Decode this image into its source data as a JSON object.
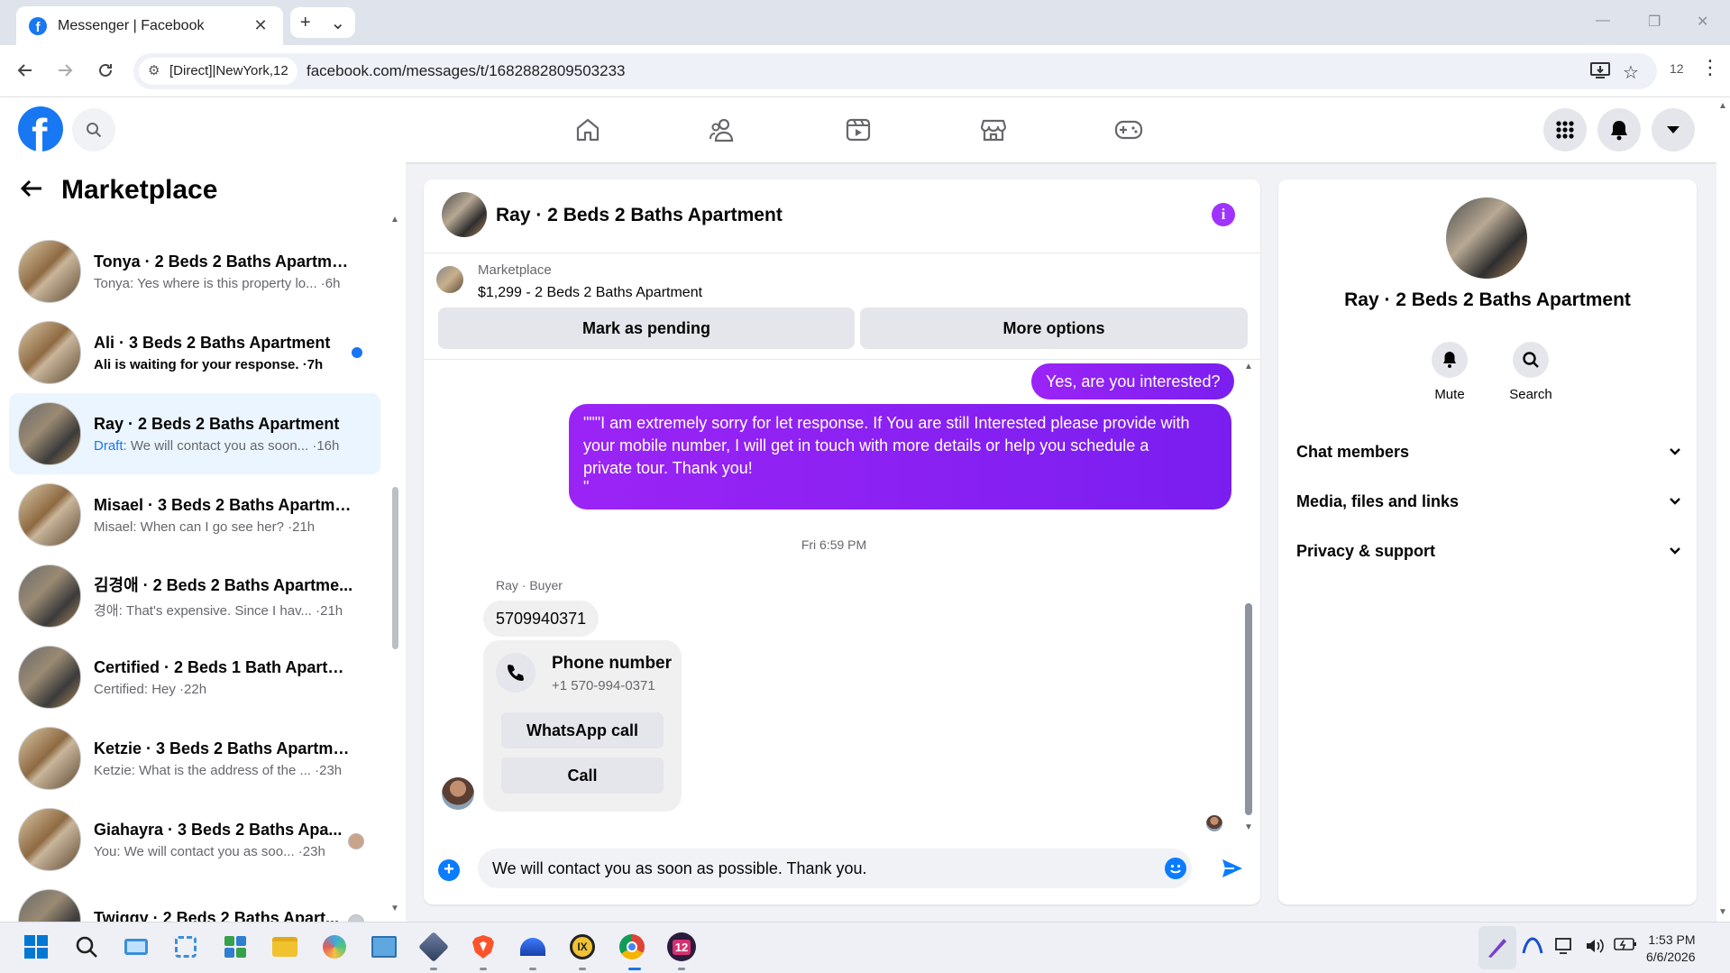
{
  "browser": {
    "tab_title": "Messenger | Facebook",
    "tab_close": "✕",
    "new_tab": "+",
    "tab_menu": "⌄",
    "site_chip": "[Direct]|NewYork,12",
    "url": "facebook.com/messages/t/1682882809503233",
    "profile_count": "12"
  },
  "marketplace": {
    "title": "Marketplace",
    "chats": [
      {
        "name": "Tonya · 2 Beds 2 Baths Apartment",
        "preview": "Tonya: Yes where is this property lo... ·6h",
        "state": "normal"
      },
      {
        "name": "Ali · 3 Beds 2 Baths Apartment",
        "preview": "Ali is waiting for your response. ·7h",
        "state": "unread"
      },
      {
        "name": "Ray · 2 Beds 2 Baths Apartment",
        "preview_prefix": "Draft:",
        "preview": " We will contact you as soon... ·16h",
        "state": "active"
      },
      {
        "name": "Misael · 3 Beds 2 Baths Apartment",
        "preview": "Misael: When can I go see her? ·21h",
        "state": "normal"
      },
      {
        "name": "김경애 · 2 Beds 2 Baths Apartme...",
        "preview": "경애: That's expensive. Since I hav... ·21h",
        "state": "normal"
      },
      {
        "name": "Certified · 2 Beds 1 Bath Apartm...",
        "preview": "Certified: Hey ·22h",
        "state": "normal"
      },
      {
        "name": "Ketzie · 3 Beds 2 Baths Apartment",
        "preview": "Ketzie: What is the address of the ... ·23h",
        "state": "normal"
      },
      {
        "name": "Giahayra · 3 Beds 2 Baths Apa...",
        "preview": "You: We will contact you as soo... ·23h",
        "state": "seen"
      },
      {
        "name": "Twiggy · 2 Beds 2 Baths Apart...",
        "preview": "",
        "state": "seen"
      }
    ]
  },
  "conversation": {
    "title": "Ray · 2 Beds 2 Baths Apartment",
    "listing_source": "Marketplace",
    "listing_title": "$1,299 - 2 Beds 2 Baths Apartment",
    "mark_pending": "Mark as pending",
    "more_options": "More options",
    "msg_out_1": "Yes, are you interested?",
    "msg_out_2_lines": [
      "\"\"\"I am extremely sorry for let response. If You are still Interested please provide with",
      "your mobile number, I will get in touch with more details or help you schedule a",
      "private tour. Thank you!",
      "\""
    ],
    "timestamp": "Fri 6:59 PM",
    "sender_label": "Ray · Buyer",
    "msg_in_1": "5709940371",
    "phone_card_title": "Phone number",
    "phone_card_number": "+1 570-994-0371",
    "whatsapp_call": "WhatsApp call",
    "call": "Call",
    "composer_value": "We will contact you as soon as possible. Thank you."
  },
  "info_panel": {
    "name": "Ray · 2 Beds 2 Baths Apartment",
    "mute": "Mute",
    "search": "Search",
    "sections": [
      "Chat members",
      "Media, files and links",
      "Privacy & support"
    ]
  },
  "taskbar": {
    "chrome_badge": "12",
    "time": "1:53 PM",
    "date": "6/6/2026"
  },
  "colors": {
    "fb_blue": "#1877f2",
    "messenger_purple": "#8b22f3",
    "active_chat_bg": "#ebf5ff"
  }
}
